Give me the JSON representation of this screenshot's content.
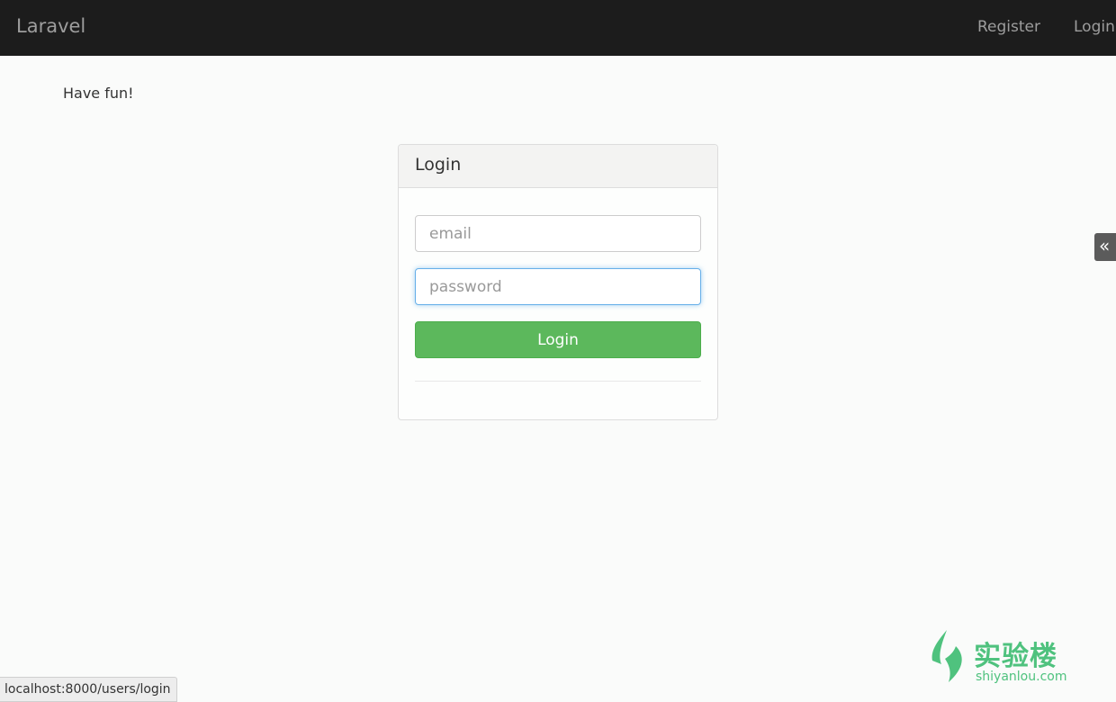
{
  "navbar": {
    "brand": "Laravel",
    "links": [
      "Register",
      "Login"
    ]
  },
  "flash_message": "Have fun!",
  "login_panel": {
    "title": "Login",
    "email_placeholder": "email",
    "password_placeholder": "password",
    "submit_label": "Login"
  },
  "side_toggle": {
    "glyph": "«",
    "icon": "double-chevron-left-icon"
  },
  "watermark": {
    "name": "实验楼",
    "url": "shiyanlou.com",
    "color": "#4fc27e",
    "icon": "leaf-logo-icon"
  },
  "status_bar": {
    "url": "localhost:8000/users/login"
  },
  "colors": {
    "navbar_bg": "#1c1c1c",
    "button_success": "#5cb85c",
    "focus_border": "#66afe9"
  }
}
